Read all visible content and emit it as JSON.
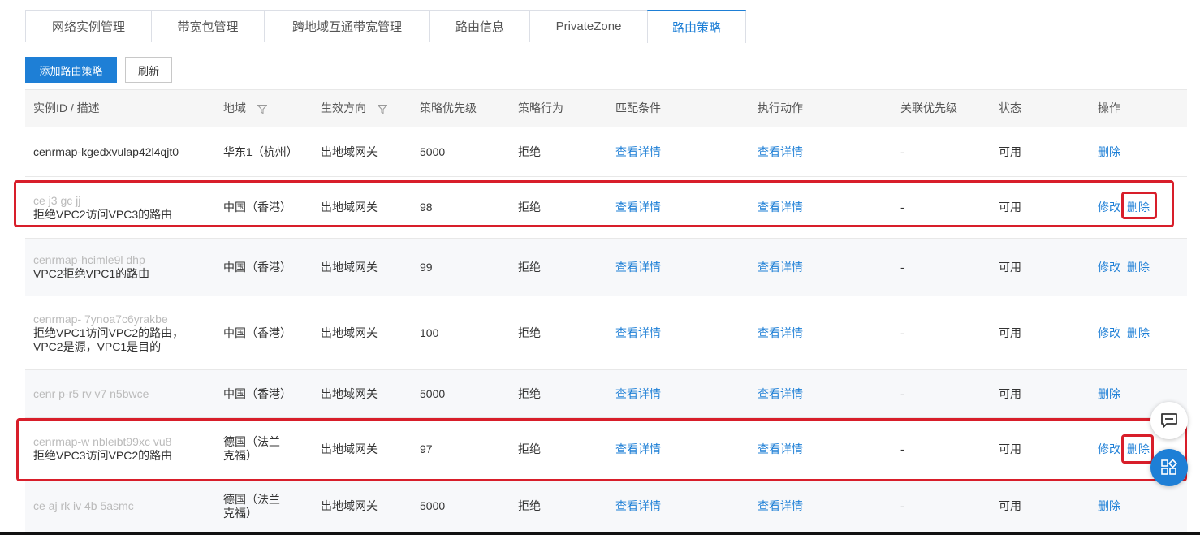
{
  "tabs": [
    "网络实例管理",
    "带宽包管理",
    "跨地域互通带宽管理",
    "路由信息",
    "PrivateZone",
    "路由策略"
  ],
  "toolbar": {
    "add_label": "添加路由策略",
    "refresh_label": "刷新"
  },
  "columns": [
    "实例ID / 描述",
    "地域",
    "生效方向",
    "策略优先级",
    "策略行为",
    "匹配条件",
    "执行动作",
    "关联优先级",
    "状态",
    "操作"
  ],
  "rows": [
    {
      "id": "cenrmap-kgedxvulap42l4qjt0",
      "desc": "",
      "region": "华东1（杭州）",
      "direction": "出地域网关",
      "priority": "5000",
      "action": "拒绝",
      "match": "查看详情",
      "exec": "查看详情",
      "assoc": "-",
      "status": "可用",
      "edit": "",
      "delete": "删除"
    },
    {
      "id": "ce j3 gc jj",
      "desc": "拒绝VPC2访问VPC3的路由",
      "region": "中国（香港）",
      "direction": "出地域网关",
      "priority": "98",
      "action": "拒绝",
      "match": "查看详情",
      "exec": "查看详情",
      "assoc": "-",
      "status": "可用",
      "edit": "修改",
      "delete": "删除"
    },
    {
      "id": "cenrmap-hcimle9l dhp",
      "desc": "VPC2拒绝VPC1的路由",
      "region": "中国（香港）",
      "direction": "出地域网关",
      "priority": "99",
      "action": "拒绝",
      "match": "查看详情",
      "exec": "查看详情",
      "assoc": "-",
      "status": "可用",
      "edit": "修改",
      "delete": "删除"
    },
    {
      "id": "cenrmap- 7ynoa7c6yrakbe",
      "desc": "拒绝VPC1访问VPC2的路由，VPC2是源，VPC1是目的",
      "region": "中国（香港）",
      "direction": "出地域网关",
      "priority": "100",
      "action": "拒绝",
      "match": "查看详情",
      "exec": "查看详情",
      "assoc": "-",
      "status": "可用",
      "edit": "修改",
      "delete": "删除"
    },
    {
      "id": "cenr p-r5 rv v7 n5bwce",
      "desc": "",
      "region": "中国（香港）",
      "direction": "出地域网关",
      "priority": "5000",
      "action": "拒绝",
      "match": "查看详情",
      "exec": "查看详情",
      "assoc": "-",
      "status": "可用",
      "edit": "",
      "delete": "删除"
    },
    {
      "id": "cenrmap-w nbleibt99xc vu8",
      "desc": "拒绝VPC3访问VPC2的路由",
      "region": "德国（法兰克福）",
      "direction": "出地域网关",
      "priority": "97",
      "action": "拒绝",
      "match": "查看详情",
      "exec": "查看详情",
      "assoc": "-",
      "status": "可用",
      "edit": "修改",
      "delete": "删除"
    },
    {
      "id": "ce aj rk iv 4b 5asmc",
      "desc": "",
      "region": "德国（法兰克福）",
      "direction": "出地域网关",
      "priority": "5000",
      "action": "拒绝",
      "match": "查看详情",
      "exec": "查看详情",
      "assoc": "-",
      "status": "可用",
      "edit": "",
      "delete": "删除"
    }
  ],
  "icons": {
    "filter": "filter-icon",
    "chat": "chat-icon",
    "apps": "apps-icon"
  },
  "colors": {
    "accent": "#1e7fd6",
    "highlight": "#d81e2a"
  }
}
